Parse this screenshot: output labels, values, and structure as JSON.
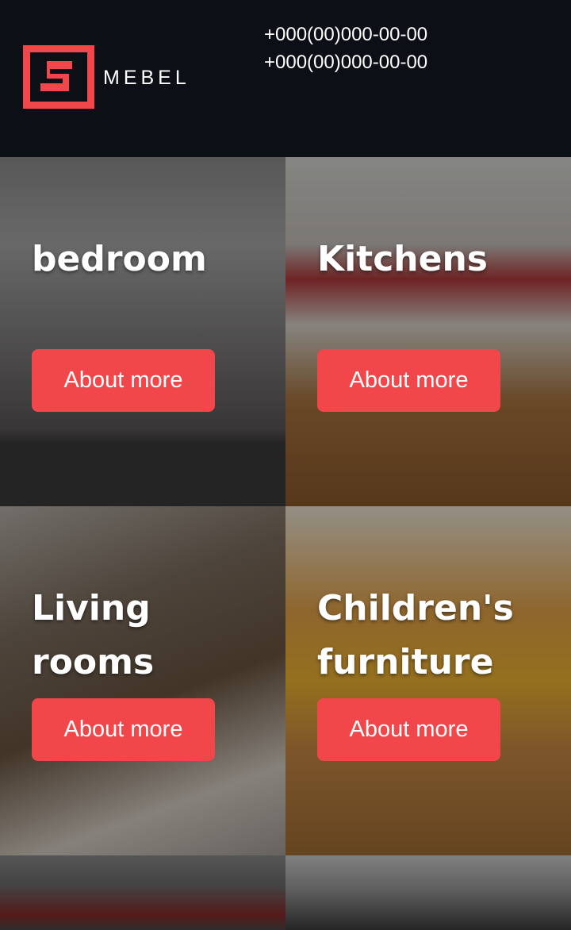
{
  "header": {
    "logo_text": "MEBEL",
    "brand_color": "#f2474a",
    "phones": [
      "+000(00)000-00-00",
      "+000(00)000-00-00"
    ]
  },
  "categories": [
    {
      "title": "bedroom",
      "button": "About more"
    },
    {
      "title": "Kitchens",
      "button": "About more"
    },
    {
      "title": "Living rooms",
      "button": "About more"
    },
    {
      "title": "Children's furniture",
      "button": "About more"
    }
  ]
}
